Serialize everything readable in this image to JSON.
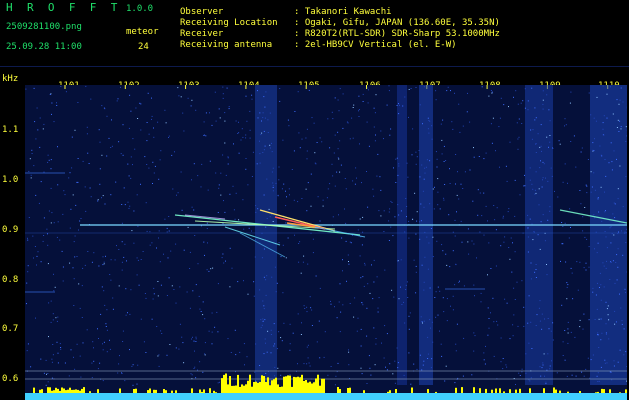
{
  "app": {
    "title": "H R O F F T",
    "version": "1.0.0"
  },
  "file": {
    "name": "2509281100.png",
    "datetime": "25.09.28 11:00"
  },
  "meteor": {
    "label": "meteor",
    "count": "24"
  },
  "info": [
    {
      "label": "Observer",
      "value": ": Takanori Kawachi"
    },
    {
      "label": "Receiving Location",
      "value": ": Ogaki, Gifu, JAPAN (136.60E, 35.35N)"
    },
    {
      "label": "Receiver",
      "value": ": R820T2(RTL-SDR) SDR-Sharp 53.1000MHz"
    },
    {
      "label": "Receiving antenna",
      "value": ": 2el-HB9CV Vertical (el. E-W)"
    }
  ],
  "axis": {
    "y_unit": "kHz",
    "y_ticks": [
      "1.1",
      "1.0",
      "0.9",
      "0.8",
      "0.7",
      "0.6"
    ],
    "x_ticks": [
      "1101",
      "1102",
      "1103",
      "1104",
      "1105",
      "1106",
      "1107",
      "1108",
      "1109",
      "1110"
    ]
  },
  "colors": {
    "background": "#000000",
    "spectrogram_bg": "#05103a",
    "title": "#1fe06a",
    "text": "#ffff3c",
    "carrier": "#7ad7ff",
    "histogram": "#ffff00",
    "baseline": "#40d0ff"
  }
}
